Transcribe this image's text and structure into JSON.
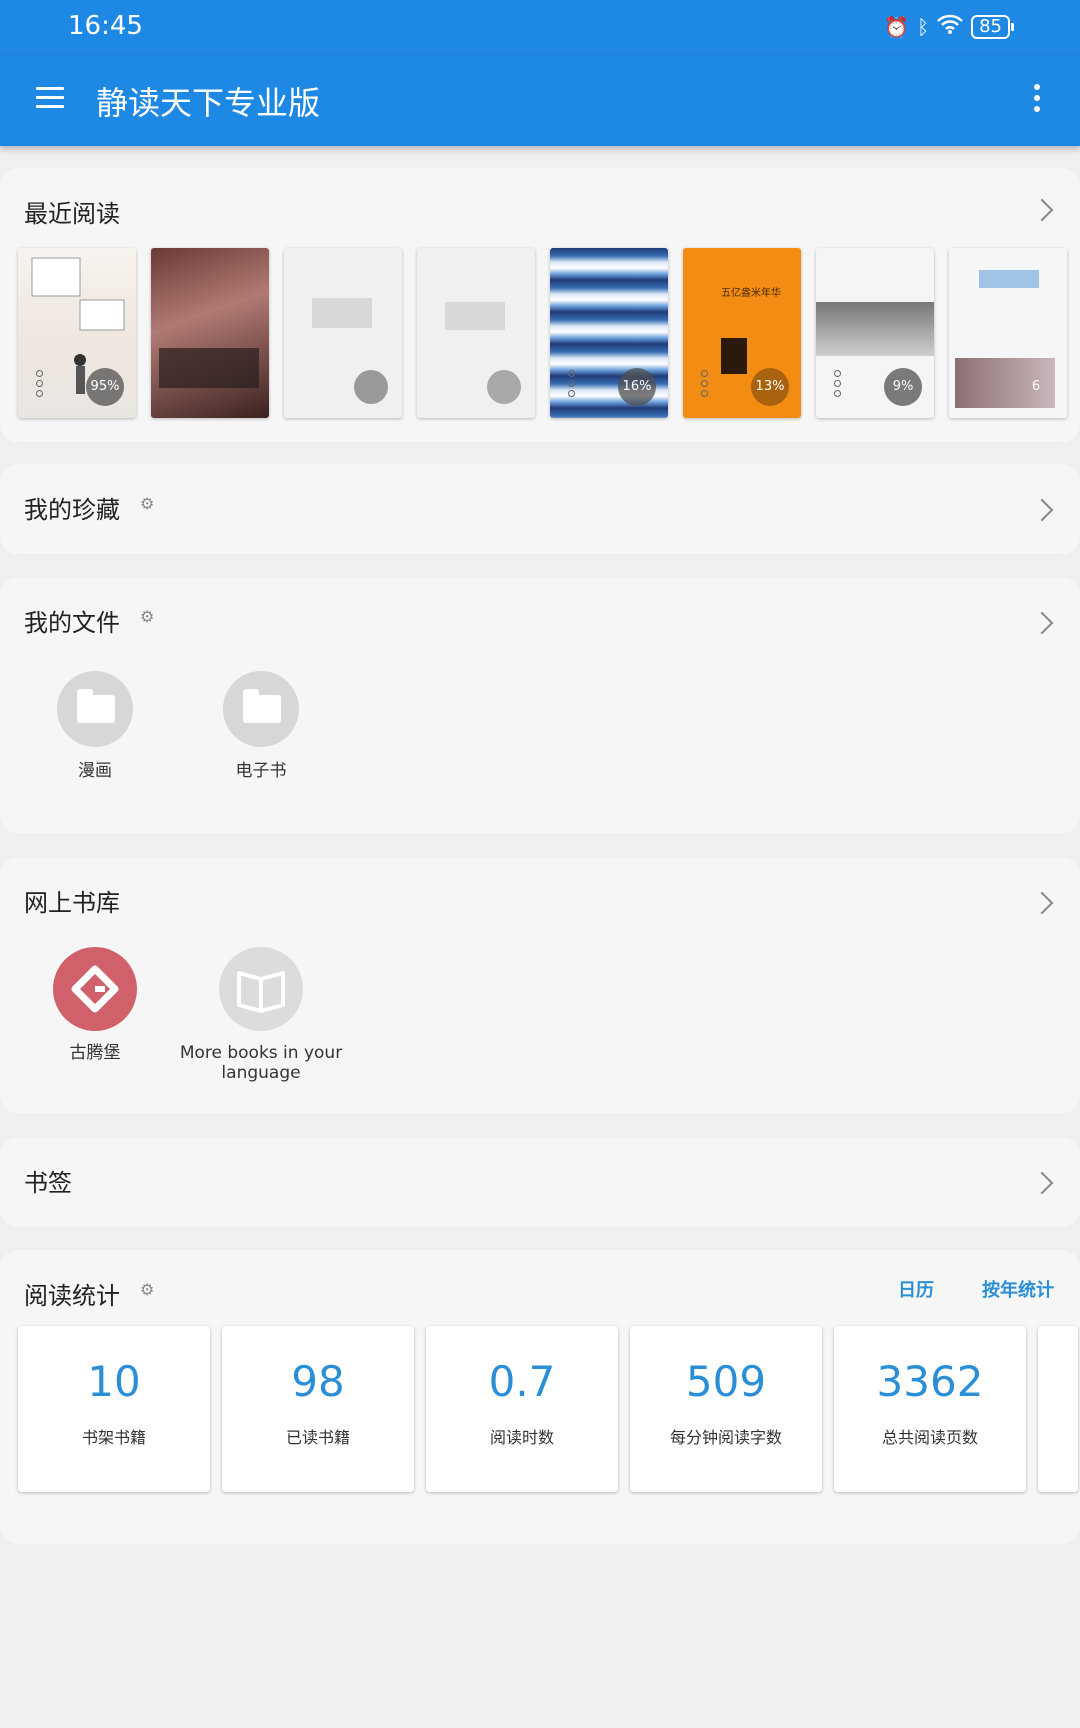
{
  "status": {
    "time": "16:45",
    "battery": "85"
  },
  "appbar": {
    "title": "静读天下专业版"
  },
  "recent": {
    "title": "最近阅读",
    "books": [
      {
        "progress": "95%"
      },
      {
        "progress": ""
      },
      {
        "progress": ""
      },
      {
        "progress": ""
      },
      {
        "progress": "16%"
      },
      {
        "progress": "13%",
        "cover_title": "五亿盎米年华"
      },
      {
        "progress": "9%"
      },
      {
        "progress": "6"
      }
    ]
  },
  "favorites": {
    "title": "我的珍藏"
  },
  "files": {
    "title": "我的文件",
    "folders": [
      {
        "label": "漫画"
      },
      {
        "label": "电子书"
      }
    ]
  },
  "online": {
    "title": "网上书库",
    "items": [
      {
        "label": "古腾堡"
      },
      {
        "label": "More books in your language"
      }
    ]
  },
  "bookmarks": {
    "title": "书签"
  },
  "stats": {
    "title": "阅读统计",
    "calendar_label": "日历",
    "yearly_label": "按年统计",
    "items": [
      {
        "value": "10",
        "label": "书架书籍"
      },
      {
        "value": "98",
        "label": "已读书籍"
      },
      {
        "value": "0.7",
        "label": "阅读时数"
      },
      {
        "value": "509",
        "label": "每分钟阅读字数"
      },
      {
        "value": "3362",
        "label": "总共阅读页数"
      }
    ]
  },
  "colors": {
    "primary": "#1e88e5",
    "accent": "#2b8fd8",
    "gutenberg": "#d0616a"
  }
}
